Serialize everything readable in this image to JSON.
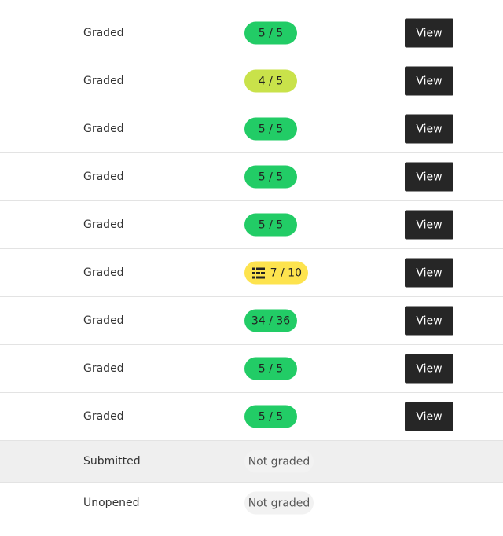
{
  "rows": [
    {
      "status": "Graded",
      "score": "5 / 5",
      "action": "View"
    },
    {
      "status": "Graded",
      "score": "4 / 5",
      "action": "View"
    },
    {
      "status": "Graded",
      "score": "5 / 5",
      "action": "View"
    },
    {
      "status": "Graded",
      "score": "5 / 5",
      "action": "View"
    },
    {
      "status": "Graded",
      "score": "5 / 5",
      "action": "View"
    },
    {
      "status": "Graded",
      "score": "7 / 10",
      "action": "View",
      "icon": "rubric-icon"
    },
    {
      "status": "Graded",
      "score": "34 / 36",
      "action": "View"
    },
    {
      "status": "Graded",
      "score": "5 / 5",
      "action": "View"
    },
    {
      "status": "Graded",
      "score": "5 / 5",
      "action": "View"
    },
    {
      "status": "Submitted",
      "score": "Not graded"
    },
    {
      "status": "Unopened",
      "score": "Not graded"
    }
  ],
  "colors": {
    "full_score": "#22cc66",
    "high_score": "#c9e24a",
    "mid_score": "#fde34e",
    "not_graded": "#f2f2f2",
    "button": "#262626"
  }
}
